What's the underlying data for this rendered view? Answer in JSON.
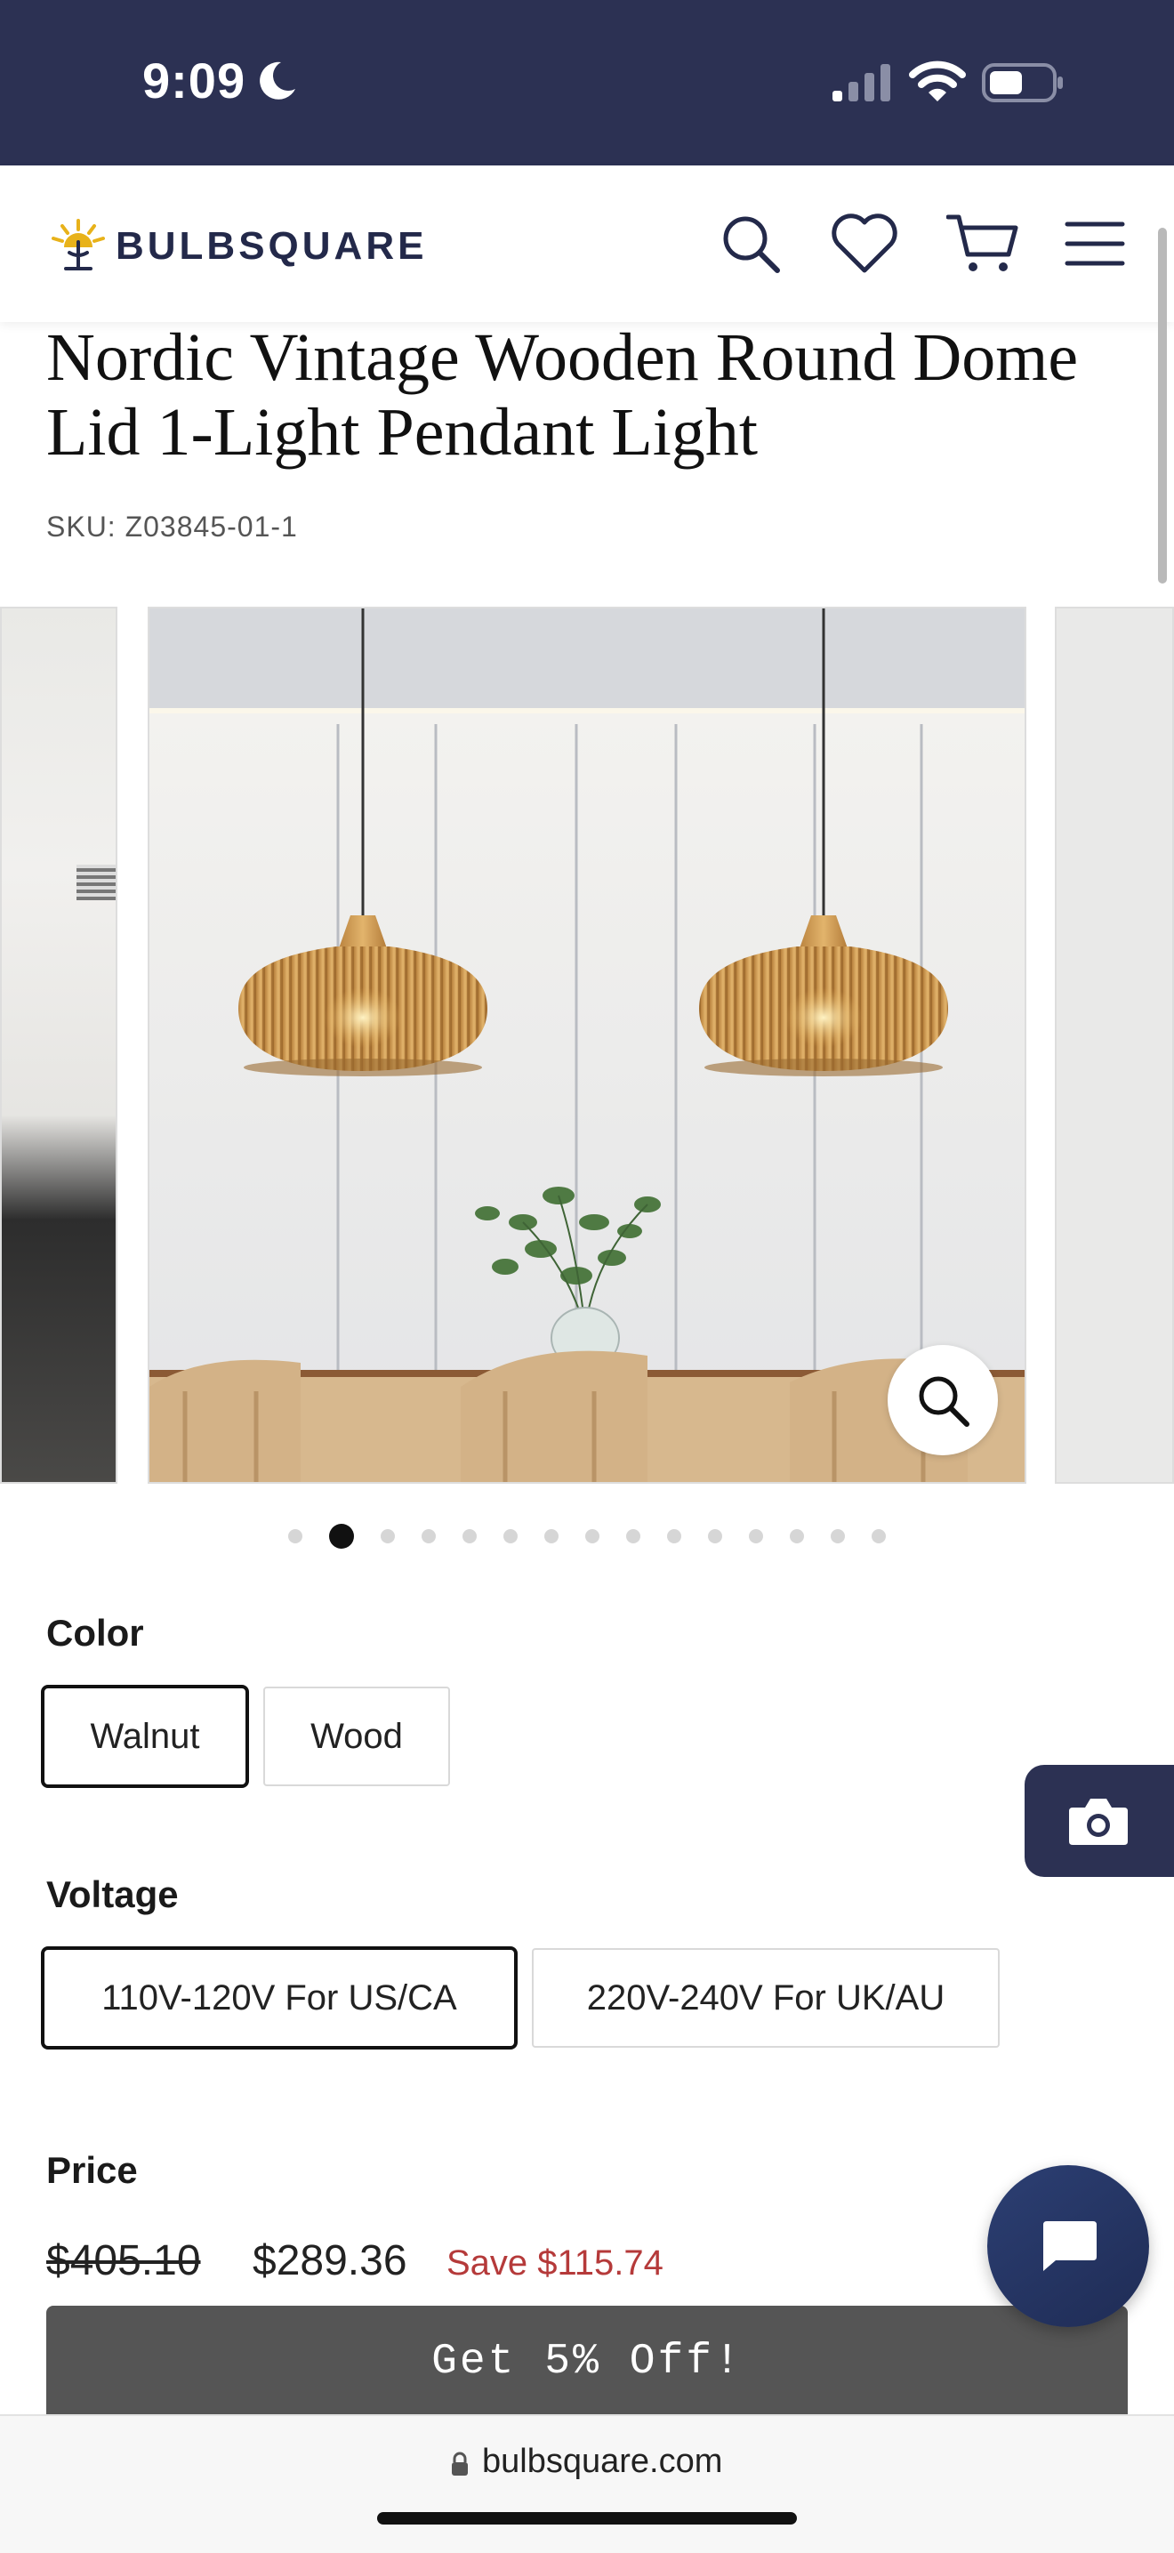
{
  "status_bar": {
    "time": "9:09",
    "icons": [
      "moon-icon",
      "cellular-signal-icon",
      "wifi-icon",
      "battery-icon"
    ]
  },
  "header": {
    "logo_text": "BULBSQUARE",
    "icons": [
      "search-icon",
      "heart-icon",
      "cart-icon",
      "hamburger-menu-icon"
    ]
  },
  "product": {
    "title": "Nordic Vintage Wooden Round Dome Lid 1-Light Pendant Light",
    "sku": "SKU: Z03845-01-1"
  },
  "gallery": {
    "total_images": 15,
    "active_index": 1,
    "zoom_icon": "zoom-icon"
  },
  "options": {
    "color": {
      "label": "Color",
      "choices": [
        "Walnut",
        "Wood"
      ],
      "selected": "Walnut"
    },
    "voltage": {
      "label": "Voltage",
      "choices": [
        "110V-120V For US/CA",
        "220V-240V For UK/AU"
      ],
      "selected": "110V-120V For US/CA"
    }
  },
  "price": {
    "label": "Price",
    "original": "$405.10",
    "current": "$289.36",
    "savings": "Save $115.74"
  },
  "promo": {
    "label": "Get 5% Off!"
  },
  "floating": {
    "camera_icon": "camera-icon",
    "chat_icon": "chat-bubble-icon"
  },
  "browser": {
    "url": "bulbsquare.com"
  },
  "colors": {
    "status_bar_bg": "#2c3153",
    "brand_navy": "#23294a",
    "sale_red": "#b53a3a",
    "promo_bg": "#555555"
  }
}
